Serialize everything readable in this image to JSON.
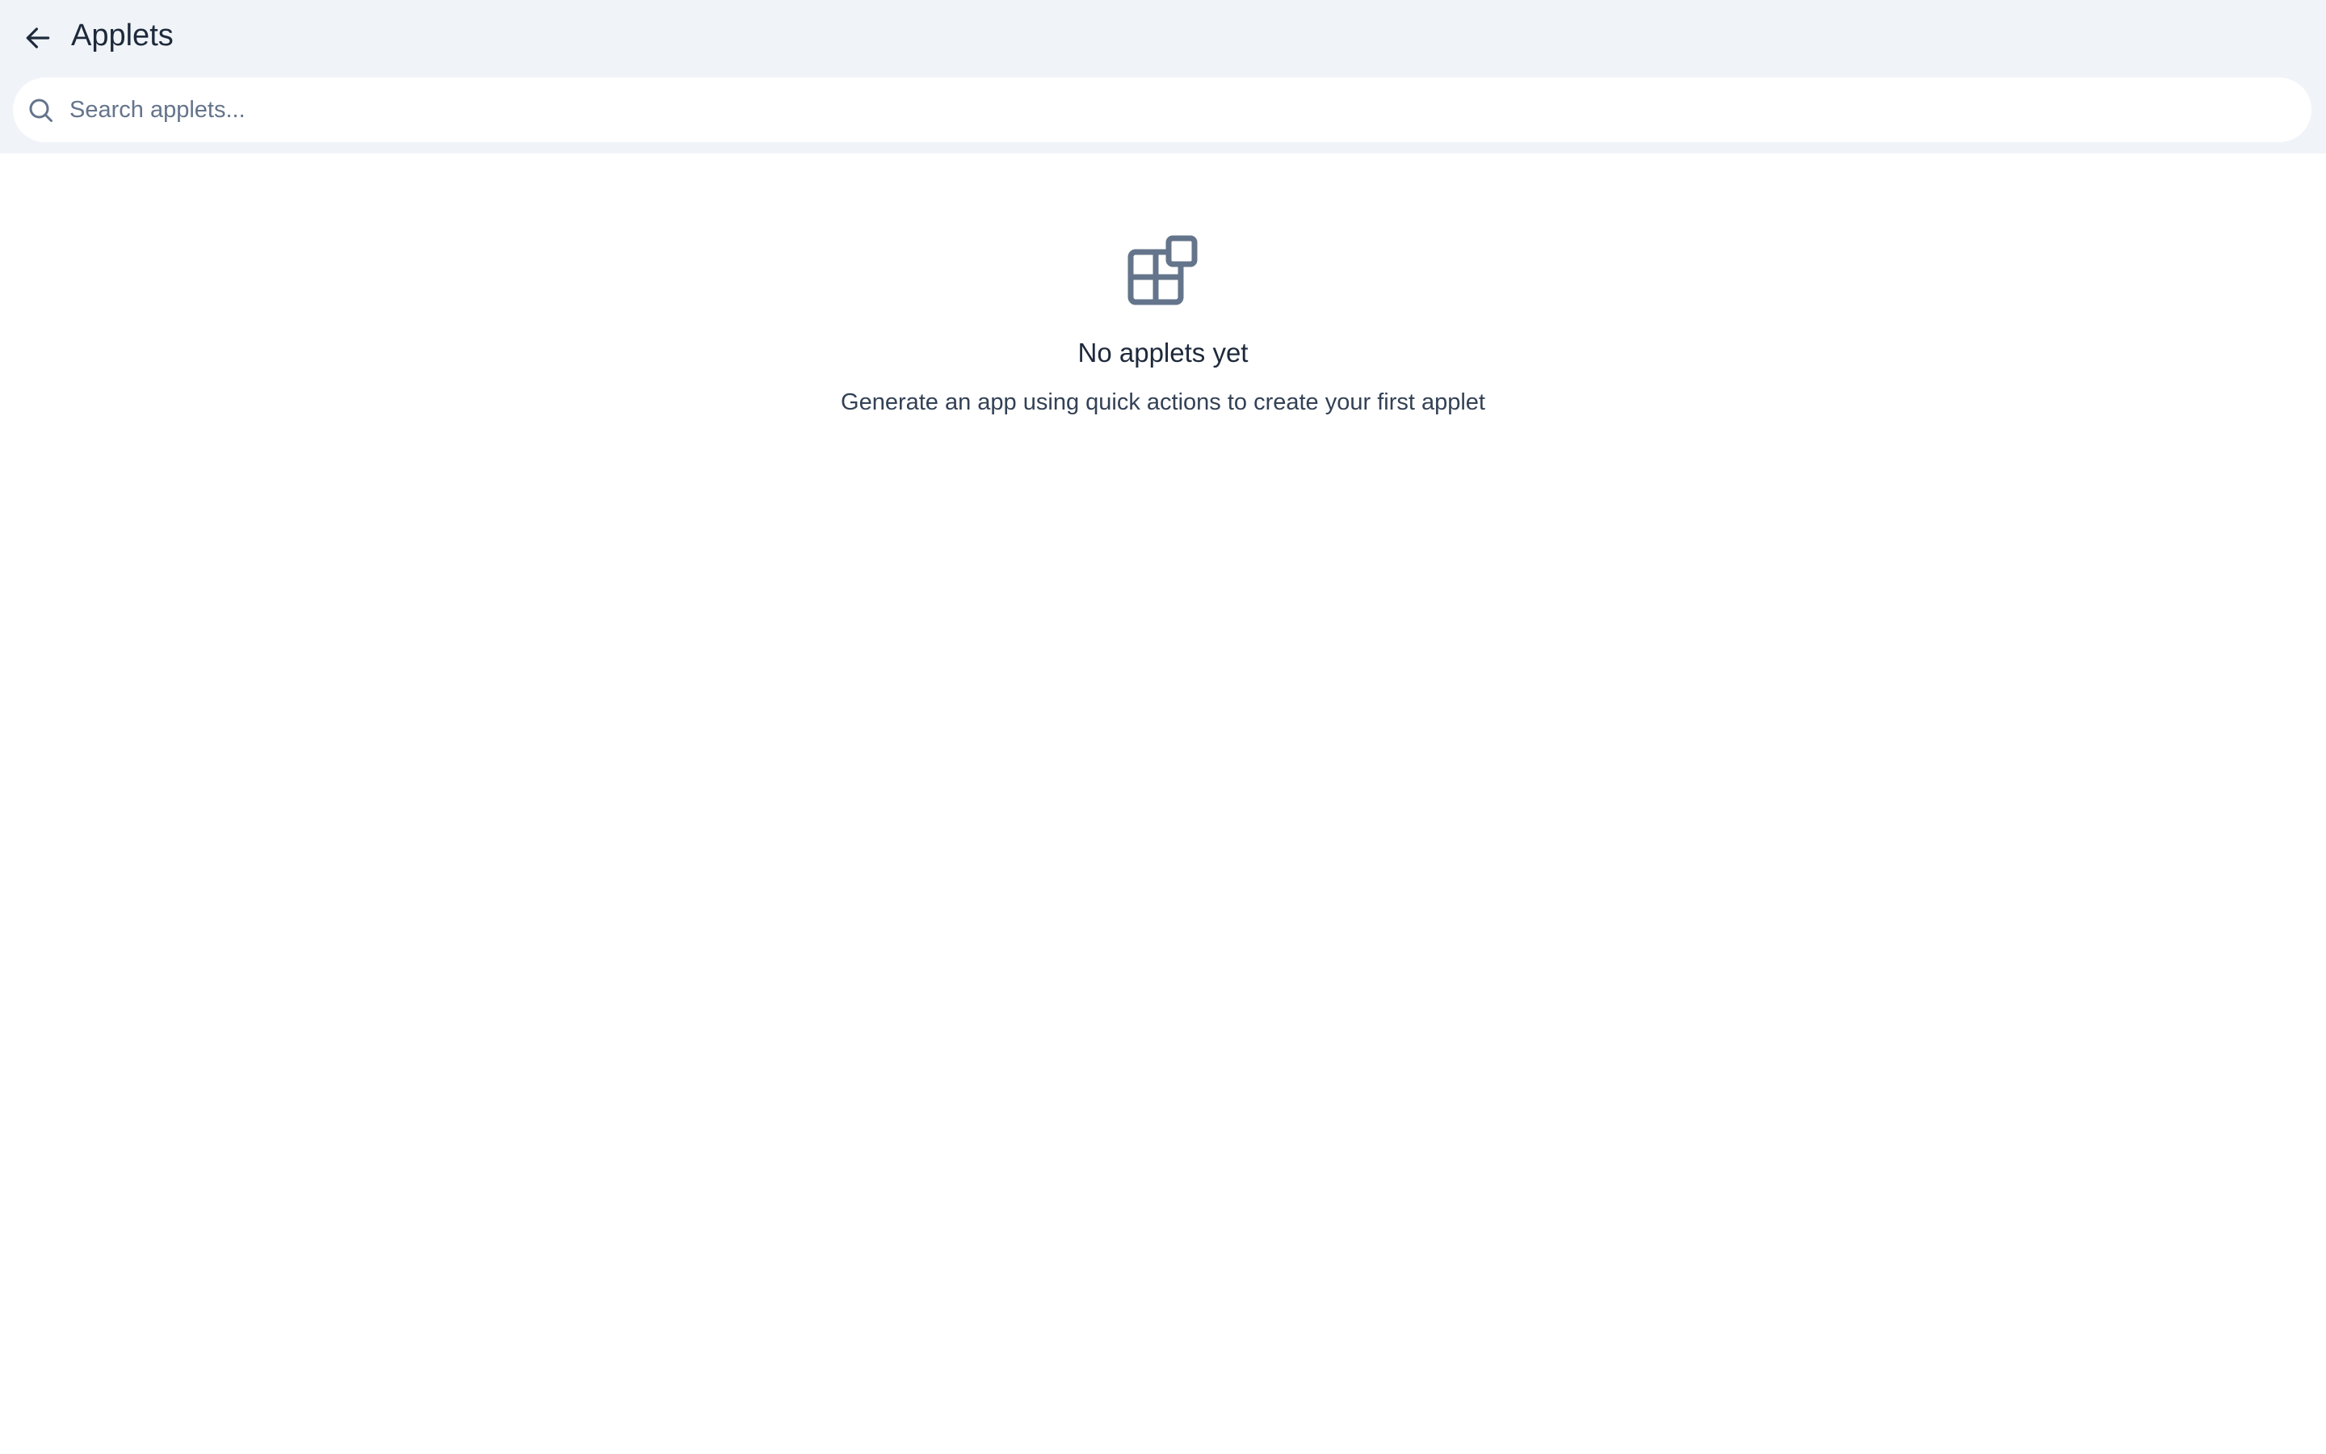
{
  "header": {
    "title": "Applets",
    "back_icon": "arrow-left-icon"
  },
  "search": {
    "placeholder": "Search applets...",
    "value": "",
    "icon": "search-icon"
  },
  "empty_state": {
    "icon": "applets-grid-icon",
    "title": "No applets yet",
    "subtitle": "Generate an app using quick actions to create your first applet"
  },
  "colors": {
    "header_background": "#f0f4f8",
    "icon_gray": "#64748b",
    "text_dark": "#1e293b"
  }
}
